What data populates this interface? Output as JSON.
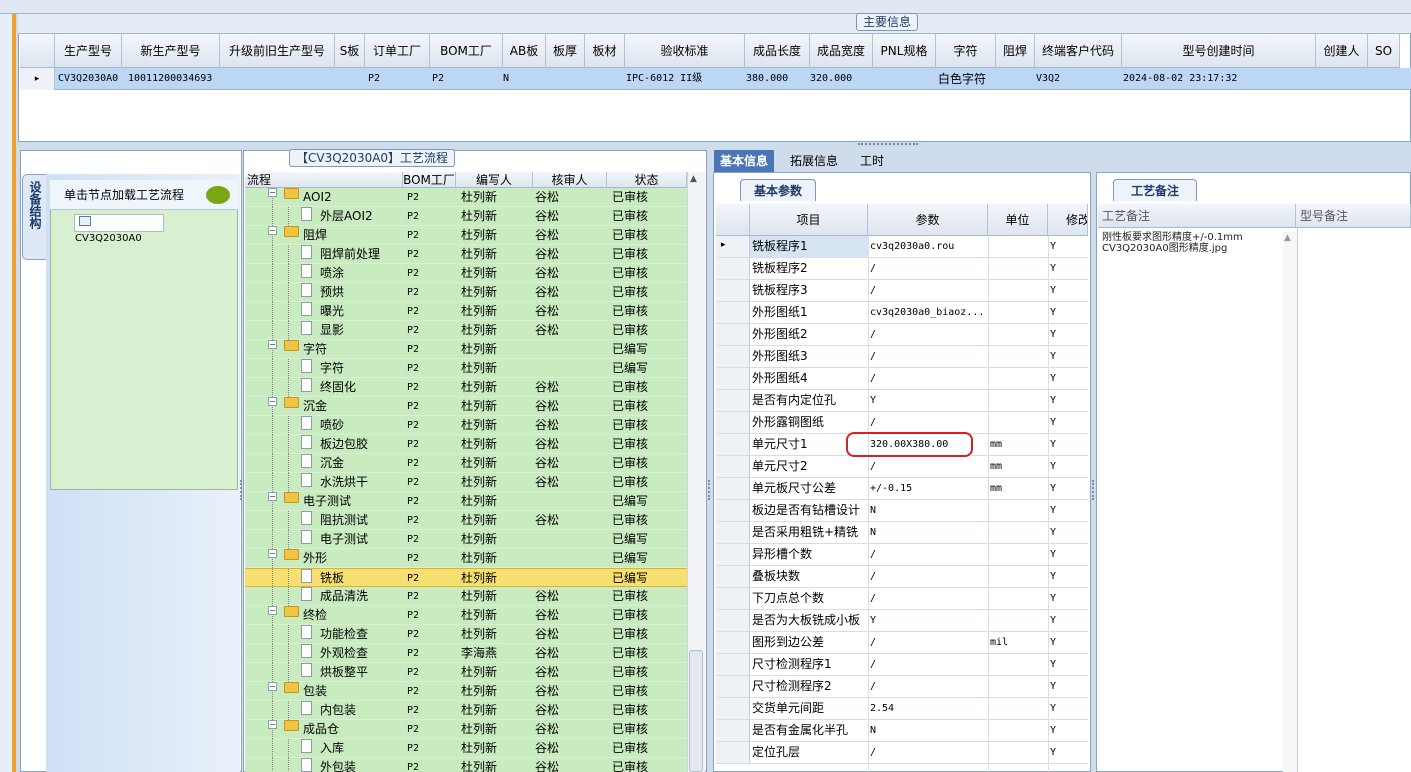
{
  "main_panel": {
    "title": "主要信息",
    "columns": [
      "生产型号",
      "新生产型号",
      "升级前旧生产型号",
      "S板",
      "订单工厂",
      "BOM工厂",
      "AB板",
      "板厚",
      "板材",
      "验收标准",
      "成品长度",
      "成品宽度",
      "PNL规格",
      "字符",
      "阻焊",
      "终端客户代码",
      "型号创建时间",
      "创建人",
      "SO"
    ],
    "row": {
      "marker": "▸",
      "prod_model": "CV3Q2030A0",
      "new_model": "10011200034693",
      "order_factory": "P2",
      "bom_factory": "P2",
      "ab_board": "N",
      "acceptance": "IPC-6012 II级",
      "length": "380.000",
      "width": "320.000",
      "char": "白色字符",
      "customer_code": "V3Q2",
      "created_time": "2024-08-02 23:17:32"
    }
  },
  "left_panel": {
    "vertical_tab": "设备结构",
    "hint": "单击节点加载工艺流程",
    "node": "CV3Q2030A0"
  },
  "process_tree": {
    "title": "【CV3Q2030A0】工艺流程",
    "columns": [
      "流程",
      "BOM工厂",
      "编写人",
      "核审人",
      "状态"
    ],
    "rows": [
      {
        "name": "AOI2",
        "level": 0,
        "bom": "P2",
        "writer": "杜列新",
        "checker": "谷松",
        "status": "已审核"
      },
      {
        "name": "外层AOI2",
        "level": 1,
        "bom": "P2",
        "writer": "杜列新",
        "checker": "谷松",
        "status": "已审核"
      },
      {
        "name": "阻焊",
        "level": 0,
        "bom": "P2",
        "writer": "杜列新",
        "checker": "谷松",
        "status": "已审核"
      },
      {
        "name": "阻焊前处理",
        "level": 1,
        "bom": "P2",
        "writer": "杜列新",
        "checker": "谷松",
        "status": "已审核"
      },
      {
        "name": "喷涂",
        "level": 1,
        "bom": "P2",
        "writer": "杜列新",
        "checker": "谷松",
        "status": "已审核"
      },
      {
        "name": "预烘",
        "level": 1,
        "bom": "P2",
        "writer": "杜列新",
        "checker": "谷松",
        "status": "已审核"
      },
      {
        "name": "曝光",
        "level": 1,
        "bom": "P2",
        "writer": "杜列新",
        "checker": "谷松",
        "status": "已审核"
      },
      {
        "name": "显影",
        "level": 1,
        "bom": "P2",
        "writer": "杜列新",
        "checker": "谷松",
        "status": "已审核"
      },
      {
        "name": "字符",
        "level": 0,
        "bom": "P2",
        "writer": "杜列新",
        "checker": "",
        "status": "已编写"
      },
      {
        "name": "字符",
        "level": 1,
        "bom": "P2",
        "writer": "杜列新",
        "checker": "",
        "status": "已编写"
      },
      {
        "name": "终固化",
        "level": 1,
        "bom": "P2",
        "writer": "杜列新",
        "checker": "谷松",
        "status": "已审核"
      },
      {
        "name": "沉金",
        "level": 0,
        "bom": "P2",
        "writer": "杜列新",
        "checker": "谷松",
        "status": "已审核"
      },
      {
        "name": "喷砂",
        "level": 1,
        "bom": "P2",
        "writer": "杜列新",
        "checker": "谷松",
        "status": "已审核"
      },
      {
        "name": "板边包胶",
        "level": 1,
        "bom": "P2",
        "writer": "杜列新",
        "checker": "谷松",
        "status": "已审核"
      },
      {
        "name": "沉金",
        "level": 1,
        "bom": "P2",
        "writer": "杜列新",
        "checker": "谷松",
        "status": "已审核"
      },
      {
        "name": "水洗烘干",
        "level": 1,
        "bom": "P2",
        "writer": "杜列新",
        "checker": "谷松",
        "status": "已审核"
      },
      {
        "name": "电子测试",
        "level": 0,
        "bom": "P2",
        "writer": "杜列新",
        "checker": "",
        "status": "已编写"
      },
      {
        "name": "阻抗测试",
        "level": 1,
        "bom": "P2",
        "writer": "杜列新",
        "checker": "谷松",
        "status": "已审核"
      },
      {
        "name": "电子测试",
        "level": 1,
        "bom": "P2",
        "writer": "杜列新",
        "checker": "",
        "status": "已编写"
      },
      {
        "name": "外形",
        "level": 0,
        "bom": "P2",
        "writer": "杜列新",
        "checker": "",
        "status": "已编写"
      },
      {
        "name": "铣板",
        "level": 1,
        "bom": "P2",
        "writer": "杜列新",
        "checker": "",
        "status": "已编写",
        "selected": true
      },
      {
        "name": "成品清洗",
        "level": 1,
        "bom": "P2",
        "writer": "杜列新",
        "checker": "谷松",
        "status": "已审核"
      },
      {
        "name": "终检",
        "level": 0,
        "bom": "P2",
        "writer": "杜列新",
        "checker": "谷松",
        "status": "已审核"
      },
      {
        "name": "功能检查",
        "level": 1,
        "bom": "P2",
        "writer": "杜列新",
        "checker": "谷松",
        "status": "已审核"
      },
      {
        "name": "外观检查",
        "level": 1,
        "bom": "P2",
        "writer": "李海燕",
        "checker": "谷松",
        "status": "已审核"
      },
      {
        "name": "烘板整平",
        "level": 1,
        "bom": "P2",
        "writer": "杜列新",
        "checker": "谷松",
        "status": "已审核"
      },
      {
        "name": "包装",
        "level": 0,
        "bom": "P2",
        "writer": "杜列新",
        "checker": "谷松",
        "status": "已审核"
      },
      {
        "name": "内包装",
        "level": 1,
        "bom": "P2",
        "writer": "杜列新",
        "checker": "谷松",
        "status": "已审核"
      },
      {
        "name": "成品仓",
        "level": 0,
        "bom": "P2",
        "writer": "杜列新",
        "checker": "谷松",
        "status": "已审核"
      },
      {
        "name": "入库",
        "level": 1,
        "bom": "P2",
        "writer": "杜列新",
        "checker": "谷松",
        "status": "已审核"
      },
      {
        "name": "外包装",
        "level": 1,
        "bom": "P2",
        "writer": "杜列新",
        "checker": "谷松",
        "status": "已审核"
      }
    ]
  },
  "right_tabs": [
    "基本信息",
    "拓展信息",
    "工时"
  ],
  "basic_params": {
    "tab": "基本参数",
    "columns": [
      "项目",
      "参数",
      "单位",
      "修改"
    ],
    "rows": [
      {
        "item": "铣板程序1",
        "param": "cv3q2030a0.rou",
        "unit": "",
        "mod": "Y"
      },
      {
        "item": "铣板程序2",
        "param": "/",
        "unit": "",
        "mod": "Y"
      },
      {
        "item": "铣板程序3",
        "param": "/",
        "unit": "",
        "mod": "Y"
      },
      {
        "item": "外形图纸1",
        "param": "cv3q2030a0_biaoz...",
        "unit": "",
        "mod": "Y"
      },
      {
        "item": "外形图纸2",
        "param": "/",
        "unit": "",
        "mod": "Y"
      },
      {
        "item": "外形图纸3",
        "param": "/",
        "unit": "",
        "mod": "Y"
      },
      {
        "item": "外形图纸4",
        "param": "/",
        "unit": "",
        "mod": "Y"
      },
      {
        "item": "是否有内定位孔",
        "param": "Y",
        "unit": "",
        "mod": "Y"
      },
      {
        "item": "外形露铜图纸",
        "param": "/",
        "unit": "",
        "mod": "Y"
      },
      {
        "item": "单元尺寸1",
        "param": "320.00X380.00",
        "unit": "mm",
        "mod": "Y"
      },
      {
        "item": "单元尺寸2",
        "param": "/",
        "unit": "mm",
        "mod": "Y"
      },
      {
        "item": "单元板尺寸公差",
        "param": "+/-0.15",
        "unit": "mm",
        "mod": "Y"
      },
      {
        "item": "板边是否有钻槽设计",
        "param": "N",
        "unit": "",
        "mod": "Y"
      },
      {
        "item": "是否采用粗铣+精铣",
        "param": "N",
        "unit": "",
        "mod": "Y"
      },
      {
        "item": "异形槽个数",
        "param": "/",
        "unit": "",
        "mod": "Y"
      },
      {
        "item": "叠板块数",
        "param": "/",
        "unit": "",
        "mod": "Y"
      },
      {
        "item": "下刀点总个数",
        "param": "/",
        "unit": "",
        "mod": "Y"
      },
      {
        "item": "是否为大板铣成小板",
        "param": "Y",
        "unit": "",
        "mod": "Y"
      },
      {
        "item": "图形到边公差",
        "param": "/",
        "unit": "mil",
        "mod": "Y"
      },
      {
        "item": "尺寸检测程序1",
        "param": "/",
        "unit": "",
        "mod": "Y"
      },
      {
        "item": "尺寸检测程序2",
        "param": "/",
        "unit": "",
        "mod": "Y"
      },
      {
        "item": "交货单元间距",
        "param": "2.54",
        "unit": "",
        "mod": "Y"
      },
      {
        "item": "是否有金属化半孔",
        "param": "N",
        "unit": "",
        "mod": "Y"
      },
      {
        "item": "定位孔层",
        "param": "/",
        "unit": "",
        "mod": "Y"
      }
    ]
  },
  "remarks": {
    "tab": "工艺备注",
    "columns": [
      "工艺备注",
      "型号备注"
    ],
    "text_line1": "刚性板要求图形精度+/-0.1mm",
    "text_line2": "CV3Q2030A0图形精度.jpg"
  },
  "icons": [
    "folder-icon",
    "document-icon",
    "expander-icon",
    "comment-bubble-icon",
    "row-marker-icon"
  ]
}
